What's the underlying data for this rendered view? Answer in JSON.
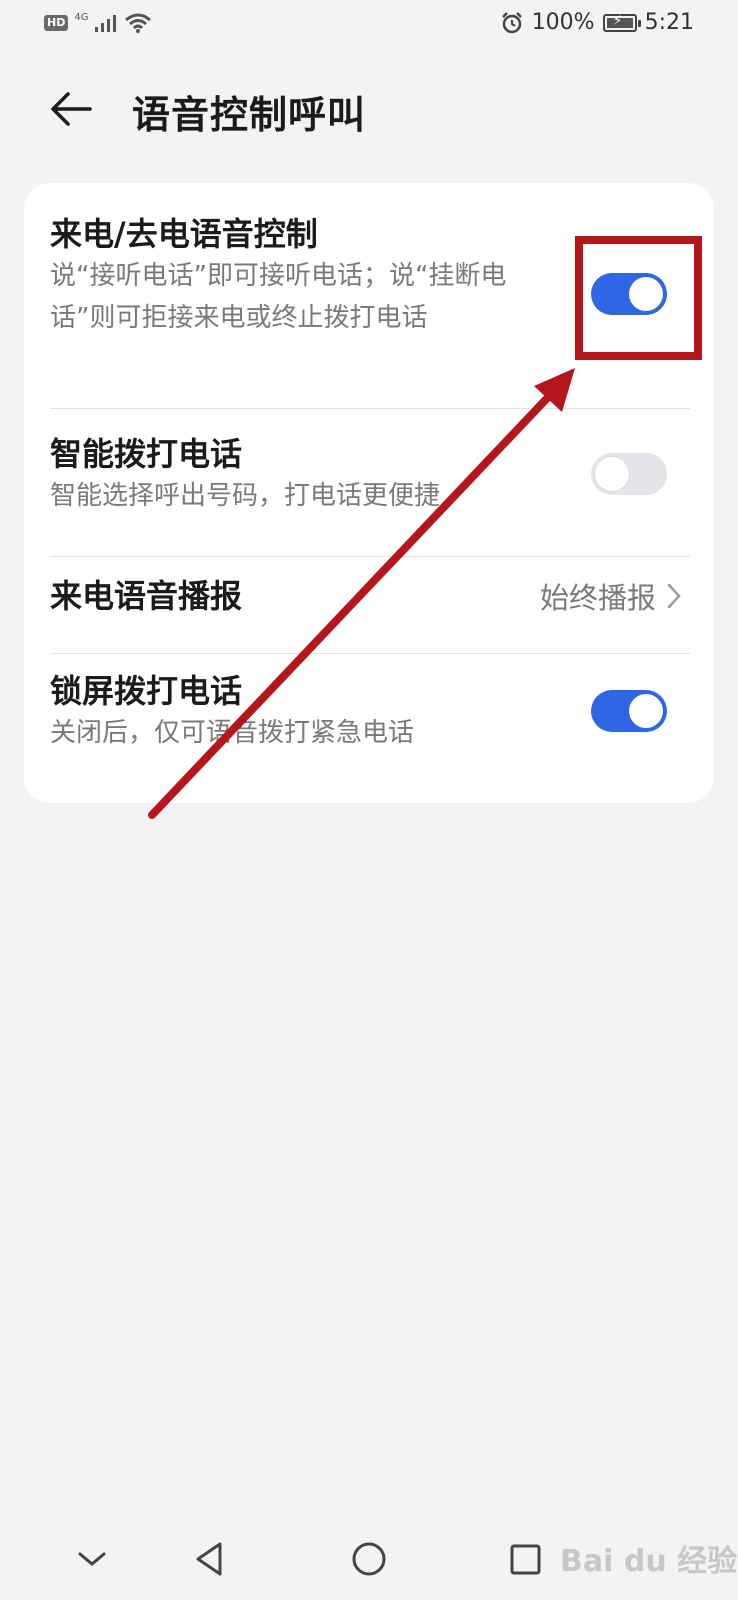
{
  "status_bar": {
    "hd": "HD",
    "network": "4G",
    "battery": "100%",
    "time": "5:21",
    "battery_level": 1.0
  },
  "header": {
    "title": "语音控制呼叫"
  },
  "settings": {
    "voice_control": {
      "title": "来电/去电语音控制",
      "desc": "说“接听电话”即可接听电话；说“挂断电话”则可拒接来电或终止拨打电话",
      "enabled": true
    },
    "smart_dial": {
      "title": "智能拨打电话",
      "desc": "智能选择呼出号码，打电话更便捷",
      "enabled": false
    },
    "announce": {
      "title": "来电语音播报",
      "value": "始终播报"
    },
    "lock_dial": {
      "title": "锁屏拨打电话",
      "desc": "关闭后，仅可语音拨打紧急电话",
      "enabled": true
    }
  },
  "colors": {
    "accent": "#2f66e6",
    "annotation": "#b5161b",
    "background": "#f1f3f5"
  },
  "watermark": "Bai du 经验"
}
